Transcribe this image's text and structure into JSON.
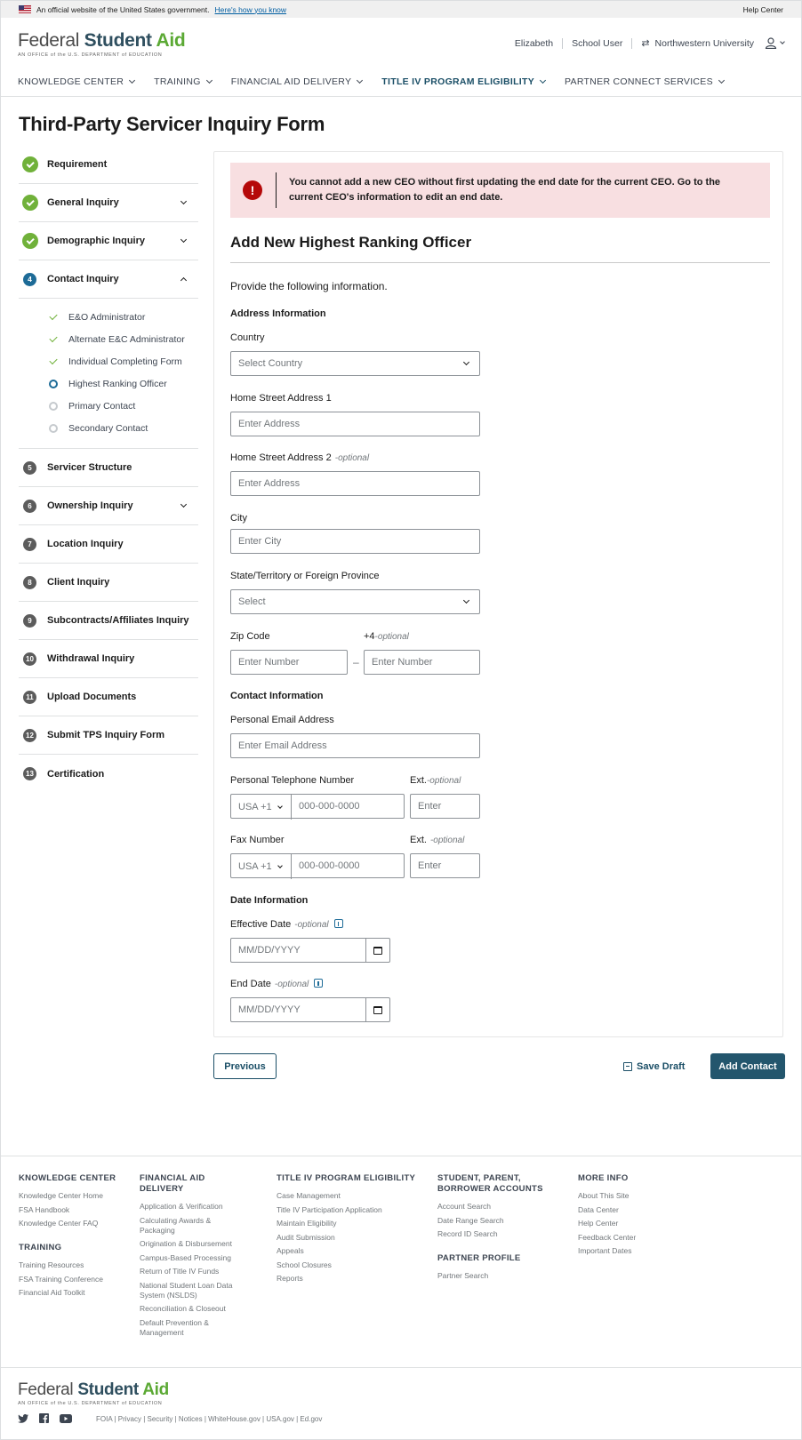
{
  "banner": {
    "text": "An official website of the United States government.",
    "link": "Here's how you know",
    "help": "Help Center"
  },
  "logo": {
    "part1": "Federal ",
    "part2": "Student ",
    "part3": "Aid",
    "sub": "AN OFFICE of the U.S. DEPARTMENT of EDUCATION"
  },
  "user": {
    "name": "Elizabeth",
    "role": "School User",
    "school": "Northwestern University"
  },
  "nav": [
    {
      "label": "KNOWLEDGE CENTER"
    },
    {
      "label": "TRAINING"
    },
    {
      "label": "FINANCIAL AID DELIVERY"
    },
    {
      "label": "TITLE IV PROGRAM ELIGIBILITY"
    },
    {
      "label": "PARTNER CONNECT SERVICES"
    }
  ],
  "page_title": "Third-Party Servicer Inquiry Form",
  "sidebar": {
    "steps": [
      {
        "label": "Requirement"
      },
      {
        "label": "General Inquiry"
      },
      {
        "label": "Demographic Inquiry"
      },
      {
        "label": "Contact Inquiry",
        "num": "4"
      },
      {
        "label": "Servicer Structure",
        "num": "5"
      },
      {
        "label": "Ownership Inquiry",
        "num": "6"
      },
      {
        "label": "Location Inquiry",
        "num": "7"
      },
      {
        "label": "Client Inquiry",
        "num": "8"
      },
      {
        "label": "Subcontracts/Affiliates Inquiry",
        "num": "9"
      },
      {
        "label": "Withdrawal Inquiry",
        "num": "10"
      },
      {
        "label": "Upload Documents",
        "num": "11"
      },
      {
        "label": "Submit TPS Inquiry Form",
        "num": "12"
      },
      {
        "label": "Certification",
        "num": "13"
      }
    ],
    "substeps": [
      {
        "label": "E&O Administrator"
      },
      {
        "label": "Alternate E&C Administrator"
      },
      {
        "label": "Individual Completing Form"
      },
      {
        "label": "Highest Ranking Officer"
      },
      {
        "label": "Primary Contact"
      },
      {
        "label": "Secondary Contact"
      }
    ]
  },
  "alert": {
    "icon": "!",
    "text": "You cannot add a new CEO without first updating the end date for the current CEO. Go to the current CEO's information to edit an end date."
  },
  "form": {
    "title": "Add New Highest Ranking Officer",
    "intro": "Provide the following information.",
    "address_heading": "Address Information",
    "country_label": "Country",
    "country_value": "Select Country",
    "street1_label": "Home Street Address 1",
    "street1_placeholder": "Enter Address",
    "street2_label": "Home Street Address 2",
    "street2_optional": "-optional",
    "street2_placeholder": "Enter Address",
    "city_label": "City",
    "city_placeholder": "Enter City",
    "state_label": "State/Territory or Foreign Province",
    "state_value": "Select",
    "zip_label": "Zip Code",
    "zip_placeholder": "Enter Number",
    "plus4_label": "+4",
    "plus4_optional": "-optional",
    "plus4_placeholder": "Enter Number",
    "dash": "–",
    "contact_heading": "Contact Information",
    "email_label": "Personal Email Address",
    "email_placeholder": "Enter Email Address",
    "phone_label": "Personal Telephone Number",
    "phone_code": "USA +1",
    "phone_placeholder": "000-000-0000",
    "ext_label": "Ext.",
    "ext_optional": "-optional",
    "ext_placeholder": "Enter",
    "fax_label": "Fax Number",
    "fax_code": "USA +1",
    "fax_placeholder": "000-000-0000",
    "fax_ext_label": "Ext.",
    "fax_ext_optional": "-optional",
    "fax_ext_placeholder": "Enter",
    "date_heading": "Date Information",
    "effective_label": "Effective Date",
    "effective_optional": "-optional",
    "effective_placeholder": "MM/DD/YYYY",
    "end_label": "End Date",
    "end_optional": "-optional",
    "end_placeholder": "MM/DD/YYYY"
  },
  "actions": {
    "previous": "Previous",
    "save_draft": "Save Draft",
    "add_contact": "Add Contact"
  },
  "footer": {
    "knowledge_center": {
      "heading": "KNOWLEDGE CENTER",
      "links": [
        "Knowledge Center Home",
        "FSA Handbook",
        "Knowledge Center FAQ"
      ]
    },
    "training": {
      "heading": "TRAINING",
      "links": [
        "Training Resources",
        "FSA Training Conference",
        "Financial Aid Toolkit"
      ]
    },
    "financial_aid_delivery": {
      "heading": "FINANCIAL AID DELIVERY",
      "links": [
        "Application & Verification",
        "Calculating Awards & Packaging",
        "Origination & Disbursement",
        "Campus-Based Processing",
        "Return of Title IV Funds",
        "National Student Loan Data System (NSLDS)",
        "Reconciliation & Closeout",
        "Default Prevention & Management"
      ]
    },
    "title_iv": {
      "heading": "TITLE IV PROGRAM ELIGIBILITY",
      "links": [
        "Case Management",
        "Title IV Participation Application",
        "Maintain Eligibility",
        "Audit Submission",
        "Appeals",
        "School Closures",
        "Reports"
      ]
    },
    "student_accounts": {
      "heading": "STUDENT, PARENT, BORROWER ACCOUNTS",
      "links": [
        "Account Search",
        "Date Range Search",
        "Record ID Search"
      ]
    },
    "partner_profile": {
      "heading": "PARTNER PROFILE",
      "links": [
        "Partner Search"
      ]
    },
    "more_info": {
      "heading": "MORE INFO",
      "links": [
        "About This Site",
        "Data Center",
        "Help Center",
        "Feedback Center",
        "Important Dates"
      ]
    },
    "bottom_links": "FOIA  |  Privacy  |  Security  |  Notices  |  WhiteHouse.gov  |  USA.gov  |  Ed.gov"
  }
}
